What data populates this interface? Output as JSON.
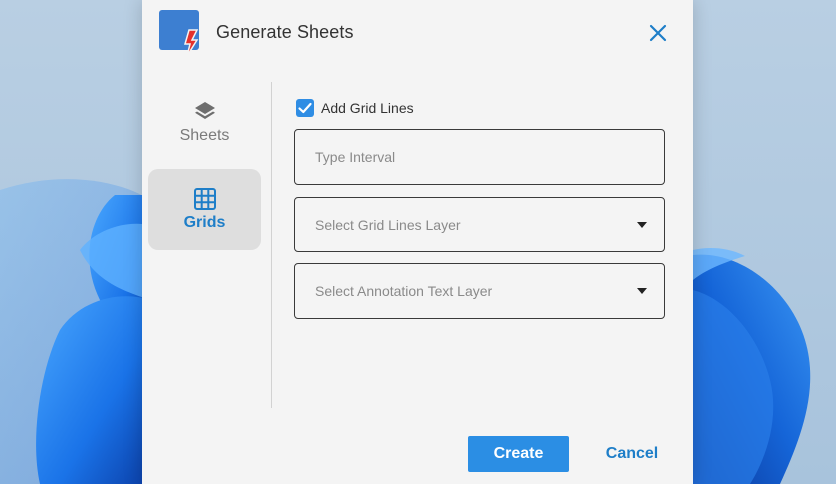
{
  "dialog": {
    "title": "Generate Sheets",
    "close_icon": "close-icon",
    "logo_icon": "app-logo-icon"
  },
  "nav": {
    "items": [
      {
        "label": "Sheets",
        "icon": "layers-icon",
        "selected": false
      },
      {
        "label": "Grids",
        "icon": "grid-icon",
        "selected": true
      }
    ]
  },
  "grids_panel": {
    "add_grid_lines": {
      "label": "Add Grid Lines",
      "checked": true
    },
    "interval": {
      "placeholder": "Type Interval",
      "value": ""
    },
    "grid_lines_layer": {
      "placeholder": "Select Grid Lines Layer"
    },
    "annotation_text_layer": {
      "placeholder": "Select Annotation Text Layer"
    }
  },
  "footer": {
    "create_label": "Create",
    "cancel_label": "Cancel"
  },
  "colors": {
    "accent": "#2b8ee4",
    "accent_text": "#1e7ec8",
    "dialog_bg": "#f4f4f4",
    "selected_nav_bg": "#dedede",
    "logo_red": "#e5322d"
  }
}
